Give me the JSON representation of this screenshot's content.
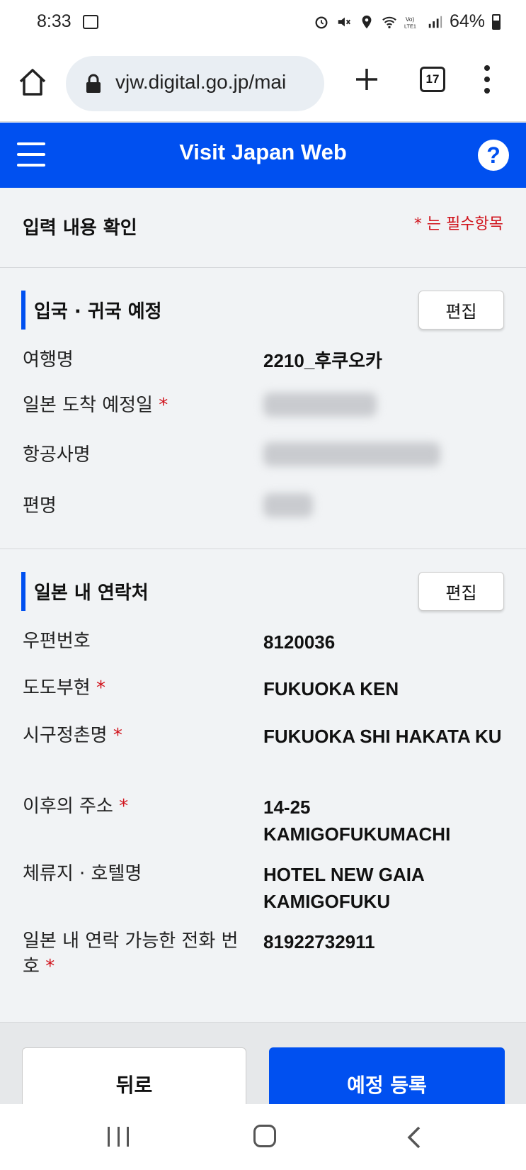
{
  "status_bar": {
    "time": "8:33",
    "battery": "64%",
    "icons": [
      "image-icon",
      "alarm-icon",
      "mute-icon",
      "location-icon",
      "wifi-icon",
      "volte-icon",
      "signal-icon",
      "battery-icon"
    ]
  },
  "browser": {
    "url": "vjw.digital.go.jp/mai",
    "tab_count": "17"
  },
  "header": {
    "title": "Visit Japan Web"
  },
  "page": {
    "title": "입력 내용 확인",
    "required_note": "* 는 필수항목"
  },
  "section1": {
    "title": "입국 · 귀국 예정",
    "edit_label": "편집",
    "rows": [
      {
        "label": "여행명",
        "value": "2210_후쿠오카"
      },
      {
        "label": "일본 도착 예정일",
        "required": "*"
      },
      {
        "label": "항공사명"
      },
      {
        "label": "편명"
      }
    ]
  },
  "section2": {
    "title": "일본 내 연락처",
    "edit_label": "편집",
    "rows": [
      {
        "label": "우편번호",
        "value": "8120036"
      },
      {
        "label": "도도부현",
        "required": "*",
        "value": "FUKUOKA KEN"
      },
      {
        "label": "시구정촌명",
        "required": "*",
        "value": "FUKUOKA SHI HAKATA KU"
      },
      {
        "label": "이후의 주소",
        "required": "*",
        "value": "14-25 KAMIGOFUKUMACHI"
      },
      {
        "label": "체류지 · 호텔명",
        "value": "HOTEL NEW GAIA KAMIGOFUKU"
      },
      {
        "label": "일본 내 연락 가능한 전화 번호",
        "required": "*",
        "value": "81922732911"
      }
    ]
  },
  "buttons": {
    "back": "뒤로",
    "register": "예정 등록"
  },
  "colors": {
    "brand_blue": "#0050f0",
    "required_red": "#d0121b"
  }
}
